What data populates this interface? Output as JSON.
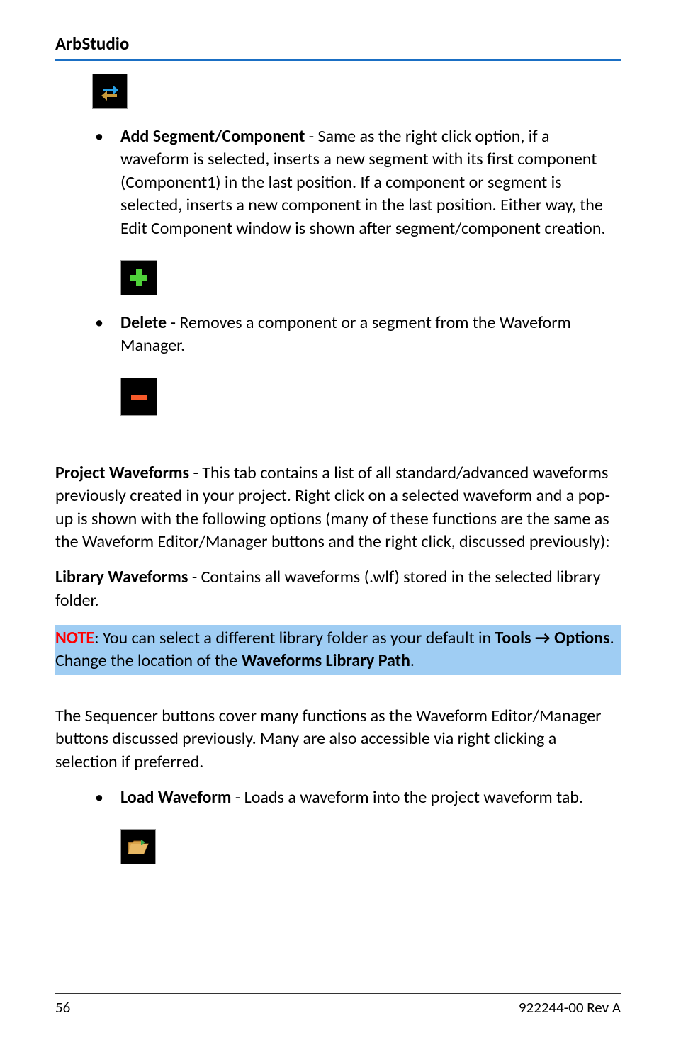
{
  "header": {
    "title": "ArbStudio"
  },
  "bullets": {
    "addSegment": {
      "title": "Add Segment/Component",
      "text": " - Same as the right click option, if a waveform is selected, inserts a new segment with its first component (Component1) in the last position. If a component or segment is selected, inserts a new component in the last position. Either way, the Edit Component window is shown after segment/component creation."
    },
    "delete": {
      "title": "Delete",
      "text": " - Removes a component or a segment from the Waveform Manager."
    },
    "loadWaveform": {
      "title": "Load Waveform",
      "text": " - Loads a waveform into the project waveform tab."
    }
  },
  "paras": {
    "projectWaveforms": {
      "title": "Project Waveforms",
      "text": " - This tab contains a list of all standard/advanced waveforms previously created in your project. Right click on a selected waveform and a pop-up is shown with the following options (many of these functions are the same as the Waveform Editor/Manager buttons and the right click, discussed previously):"
    },
    "libraryWaveforms": {
      "title": "Library Waveforms",
      "text": " - Contains all waveforms (.wlf) stored in the selected library folder."
    },
    "sequencer": "The Sequencer buttons cover many functions as the Waveform Editor/Manager buttons discussed previously. Many are also accessible via right clicking a selection if preferred."
  },
  "note": {
    "label": "NOTE",
    "text1": ": You can select a different library folder as your default in ",
    "bold1": "Tools → Options",
    "text2": ". Change the location of the ",
    "bold2": "Waveforms Library Path",
    "text3": "."
  },
  "footer": {
    "page": "56",
    "rev": "922244-00 Rev A"
  }
}
